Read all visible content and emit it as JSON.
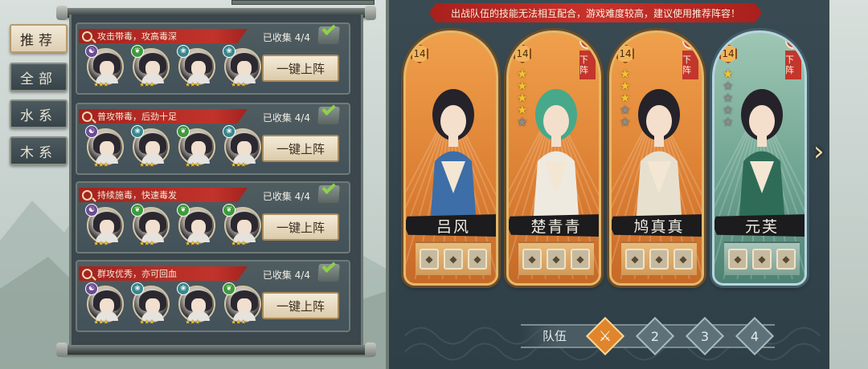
{
  "tabs": [
    {
      "label": "推荐",
      "active": true
    },
    {
      "label": "全部",
      "active": false
    },
    {
      "label": "水系",
      "active": false
    },
    {
      "label": "木系",
      "active": false
    }
  ],
  "teams": [
    {
      "tag": "攻击带毒，攻高毒深",
      "collected": "已收集 4/4",
      "button": "一键上阵",
      "avatars": [
        {
          "element": "purple",
          "stars": "★★★"
        },
        {
          "element": "green",
          "stars": "★★★"
        },
        {
          "element": "teal",
          "stars": "★★★"
        },
        {
          "element": "teal",
          "stars": "★★★"
        }
      ]
    },
    {
      "tag": "普攻带毒，后劲十足",
      "collected": "已收集 4/4",
      "button": "一键上阵",
      "avatars": [
        {
          "element": "purple",
          "stars": "★★★"
        },
        {
          "element": "teal",
          "stars": "★★★"
        },
        {
          "element": "green",
          "stars": "★★★"
        },
        {
          "element": "teal",
          "stars": "★★★"
        }
      ]
    },
    {
      "tag": "持续施毒，快速毒发",
      "collected": "已收集 4/4",
      "button": "一键上阵",
      "avatars": [
        {
          "element": "purple",
          "stars": "★★★"
        },
        {
          "element": "green",
          "stars": "★★★"
        },
        {
          "element": "green",
          "stars": "★★★"
        },
        {
          "element": "green",
          "stars": "★★★"
        }
      ]
    },
    {
      "tag": "群攻优秀，亦可回血",
      "collected": "已收集 4/4",
      "button": "一键上阵",
      "avatars": [
        {
          "element": "purple",
          "stars": "★★★"
        },
        {
          "element": "teal",
          "stars": "★★★"
        },
        {
          "element": "teal",
          "stars": "★★★"
        },
        {
          "element": "green",
          "stars": "★★★"
        }
      ]
    }
  ],
  "warning": "出战队伍的技能无法相互配合，游戏难度较高，建议使用推荐阵容！",
  "heroes": [
    {
      "name": "吕风",
      "level": "14",
      "stars_on": 0,
      "stars_off": 0,
      "removable": false,
      "style": "orange",
      "equip": [
        "sword-icon",
        "armor-icon",
        "boot-icon"
      ]
    },
    {
      "name": "楚青青",
      "level": "14",
      "stars_on": 4,
      "stars_off": 1,
      "removable": true,
      "style": "orange",
      "equip": [
        "sword-icon",
        "armor-icon",
        "boot-icon"
      ]
    },
    {
      "name": "鸠真真",
      "level": "14",
      "stars_on": 3,
      "stars_off": 2,
      "removable": true,
      "style": "orange",
      "equip": [
        "axe-icon",
        "armor-icon",
        "boot-icon"
      ]
    },
    {
      "name": "元芙",
      "level": "14",
      "stars_on": 1,
      "stars_off": 4,
      "removable": true,
      "style": "blue",
      "equip": [
        "sword-icon",
        "armor-icon",
        "ring-icon"
      ]
    }
  ],
  "remove_label": "下阵",
  "team_selector": {
    "label": "队伍",
    "slots": [
      "1",
      "2",
      "3",
      "4"
    ],
    "active_index": 0
  },
  "colors": {
    "tag_red": "#c1332b",
    "card_orange": "#dc7f33",
    "card_blue": "#6da290",
    "star_gold": "#f3c531"
  }
}
